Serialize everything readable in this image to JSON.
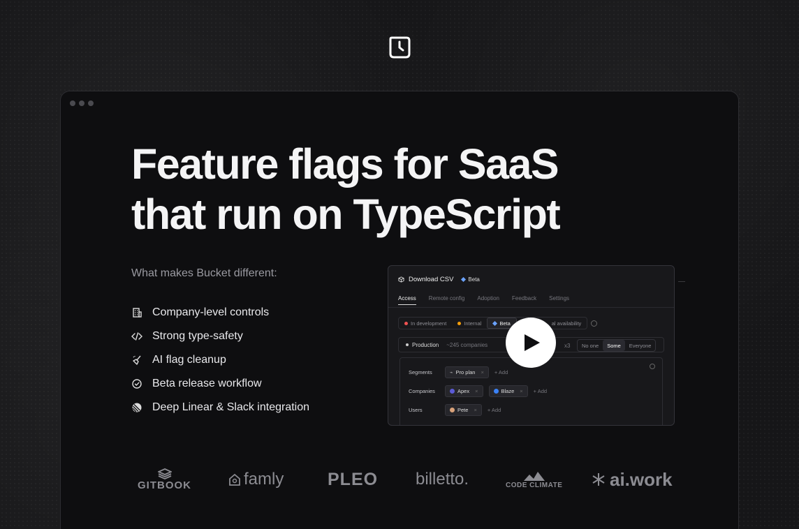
{
  "headline": {
    "line1": "Feature flags for SaaS",
    "line2": "that run on TypeScript"
  },
  "subheading": "What makes Bucket different:",
  "features": [
    {
      "icon": "building-icon",
      "label": "Company-level controls"
    },
    {
      "icon": "code-icon",
      "label": "Strong type-safety"
    },
    {
      "icon": "broom-icon",
      "label": "AI flag cleanup"
    },
    {
      "icon": "check-circle-icon",
      "label": "Beta release workflow"
    },
    {
      "icon": "linear-icon",
      "label": "Deep Linear & Slack integration"
    }
  ],
  "preview": {
    "title": "Download CSV",
    "badge": "Beta",
    "tabs": [
      "Access",
      "Remote config",
      "Adoption",
      "Feedback",
      "Settings"
    ],
    "stages": [
      {
        "label": "In development",
        "color": "#f05252"
      },
      {
        "label": "Internal",
        "color": "#f59e0b"
      },
      {
        "label": "Beta",
        "color": "#6aa2ff"
      },
      {
        "label": "al availability",
        "color": ""
      }
    ],
    "environment": "Production",
    "company_count": "~245 companies",
    "multiplier": "x3",
    "audience_options": [
      "No one",
      "Some",
      "Everyone"
    ],
    "segments_label": "Segments",
    "segment_chip": "Pro plan",
    "companies_label": "Companies",
    "company_chips": [
      "Apex",
      "Blaze"
    ],
    "users_label": "Users",
    "user_chip": "Pete",
    "add_label": "Add",
    "remove_label": "×"
  },
  "customer_logos": [
    "GITBOOK",
    "famly",
    "PLEO",
    "billetto.",
    "CODE CLIMATE",
    "ai.work"
  ],
  "colors": {
    "background": "#161618",
    "window": "#0e0e10",
    "text": "#f4f4f5",
    "muted": "#9a9aa1",
    "logo": "#8c8c92"
  }
}
